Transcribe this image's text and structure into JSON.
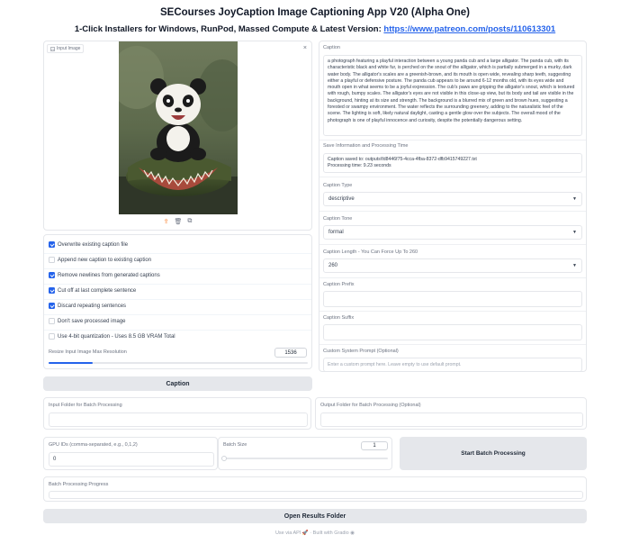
{
  "header": {
    "title": "SECourses JoyCaption Image Captioning App V20 (Alpha One)",
    "subtitle_prefix": "1-Click Installers for Windows, RunPod, Massed Compute & Latest Version: ",
    "subtitle_link": "https://www.patreon.com/posts/110613301"
  },
  "image_panel": {
    "label": "Input Image",
    "close": "×",
    "tools": [
      "upload-icon",
      "clear-icon",
      "copy-icon"
    ]
  },
  "options": [
    {
      "label": "Overwrite existing caption file",
      "checked": true
    },
    {
      "label": "Append new caption to existing caption",
      "checked": false
    },
    {
      "label": "Remove newlines from generated captions",
      "checked": true
    },
    {
      "label": "Cut off at last complete sentence",
      "checked": true
    },
    {
      "label": "Discard repeating sentences",
      "checked": true
    },
    {
      "label": "Don't save processed image",
      "checked": false
    },
    {
      "label": "Use 4-bit quantization - Uses 8.5 GB VRAM Total",
      "checked": false
    }
  ],
  "resize": {
    "label": "Resize Input Image Max Resolution",
    "value": "1536",
    "fill_fraction": 0.17
  },
  "caption_button": "Caption",
  "right": {
    "caption_label": "Caption",
    "caption_text": "a photograph featuring a playful interaction between a young panda cub and a large alligator. The panda cub, with its characteristic black and white fur, is perched on the snout of the alligator, which is partially submerged in a murky, dark water body. The alligator's scales are a greenish-brown, and its mouth is open wide, revealing sharp teeth, suggesting either a playful or defensive posture. The panda cub appears to be around 6-12 months old, with its eyes wide and mouth open in what seems to be a joyful expression. The cub's paws are gripping the alligator's snout, which is textured with rough, bumpy scales. The alligator's eyes are not visible in this close-up view, but its body and tail are visible in the background, hinting at its size and strength. The background is a blurred mix of green and brown hues, suggesting a forested or swampy environment. The water reflects the surrounding greenery, adding to the naturalistic feel of the scene. The lighting is soft, likely natural daylight, casting a gentle glow over the subjects. The overall mood of the photograph is one of playful innocence and curiosity, despite the potentially dangerous setting.",
    "save_label": "Save Information and Processing Time",
    "save_line1": "Caption saved to: outputs\\fd8446f75-4cca-4fba-8372-dfb9415749227.txt",
    "save_line2": "Processing time: 9.23 seconds",
    "type_label": "Caption Type",
    "type_value": "descriptive",
    "tone_label": "Caption Tone",
    "tone_value": "formal",
    "length_label": "Caption Length - You Can Force Up To 260",
    "length_value": "260",
    "prefix_label": "Caption Prefix",
    "suffix_label": "Caption Suffix",
    "prompt_label": "Custom System Prompt (Optional)",
    "prompt_placeholder": "Enter a custom prompt here. Leave empty to use default prompt."
  },
  "batch": {
    "input_label": "Input Folder for Batch Processing",
    "output_label": "Output Folder for Batch Processing (Optional)",
    "gpu_label": "GPU IDs (comma-separated, e.g., 0,1,2)",
    "gpu_value": "0",
    "size_label": "Batch Size",
    "size_value": "1",
    "start_button": "Start Batch Processing",
    "progress_label": "Batch Processing Progress",
    "results_button": "Open Results Folder"
  },
  "footer": {
    "api": "Use via API",
    "sep": "·",
    "built": "Built with Gradio"
  }
}
